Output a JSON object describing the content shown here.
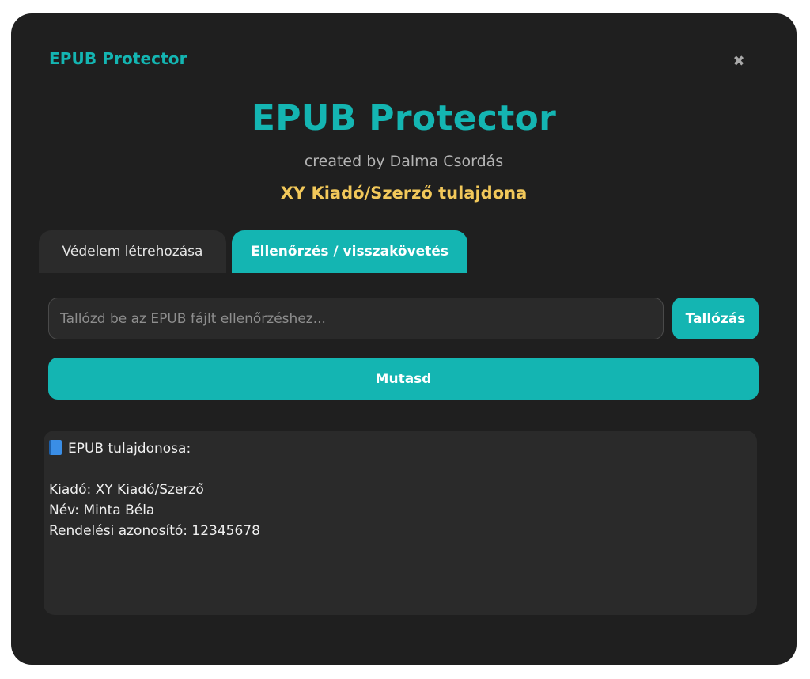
{
  "window": {
    "title": "EPUB Protector",
    "close_glyph": "✖"
  },
  "hero": {
    "title": "EPUB Protector",
    "subtitle": "created by Dalma Csordás",
    "owner": "XY Kiadó/Szerző tulajdona"
  },
  "tabs": [
    {
      "label": "Védelem létrehozása",
      "active": false
    },
    {
      "label": "Ellenőrzés / visszakövetés",
      "active": true
    }
  ],
  "file_picker": {
    "value": "",
    "placeholder": "Tallózd be az EPUB fájlt ellenőrzéshez...",
    "browse_label": "Tallózás"
  },
  "show_button": {
    "label": "Mutasd"
  },
  "output": {
    "heading_icon": "book-icon",
    "heading": "EPUB tulajdonosa:",
    "lines": [
      "",
      "Kiadó: XY Kiadó/Szerző",
      "Név: Minta Béla",
      "Rendelési azonosító: 12345678"
    ]
  },
  "colors": {
    "accent": "#14b5b2",
    "owner_highlight": "#f2c85a",
    "window_bg": "#1f1f1f",
    "panel_bg": "#2a2a2a"
  }
}
